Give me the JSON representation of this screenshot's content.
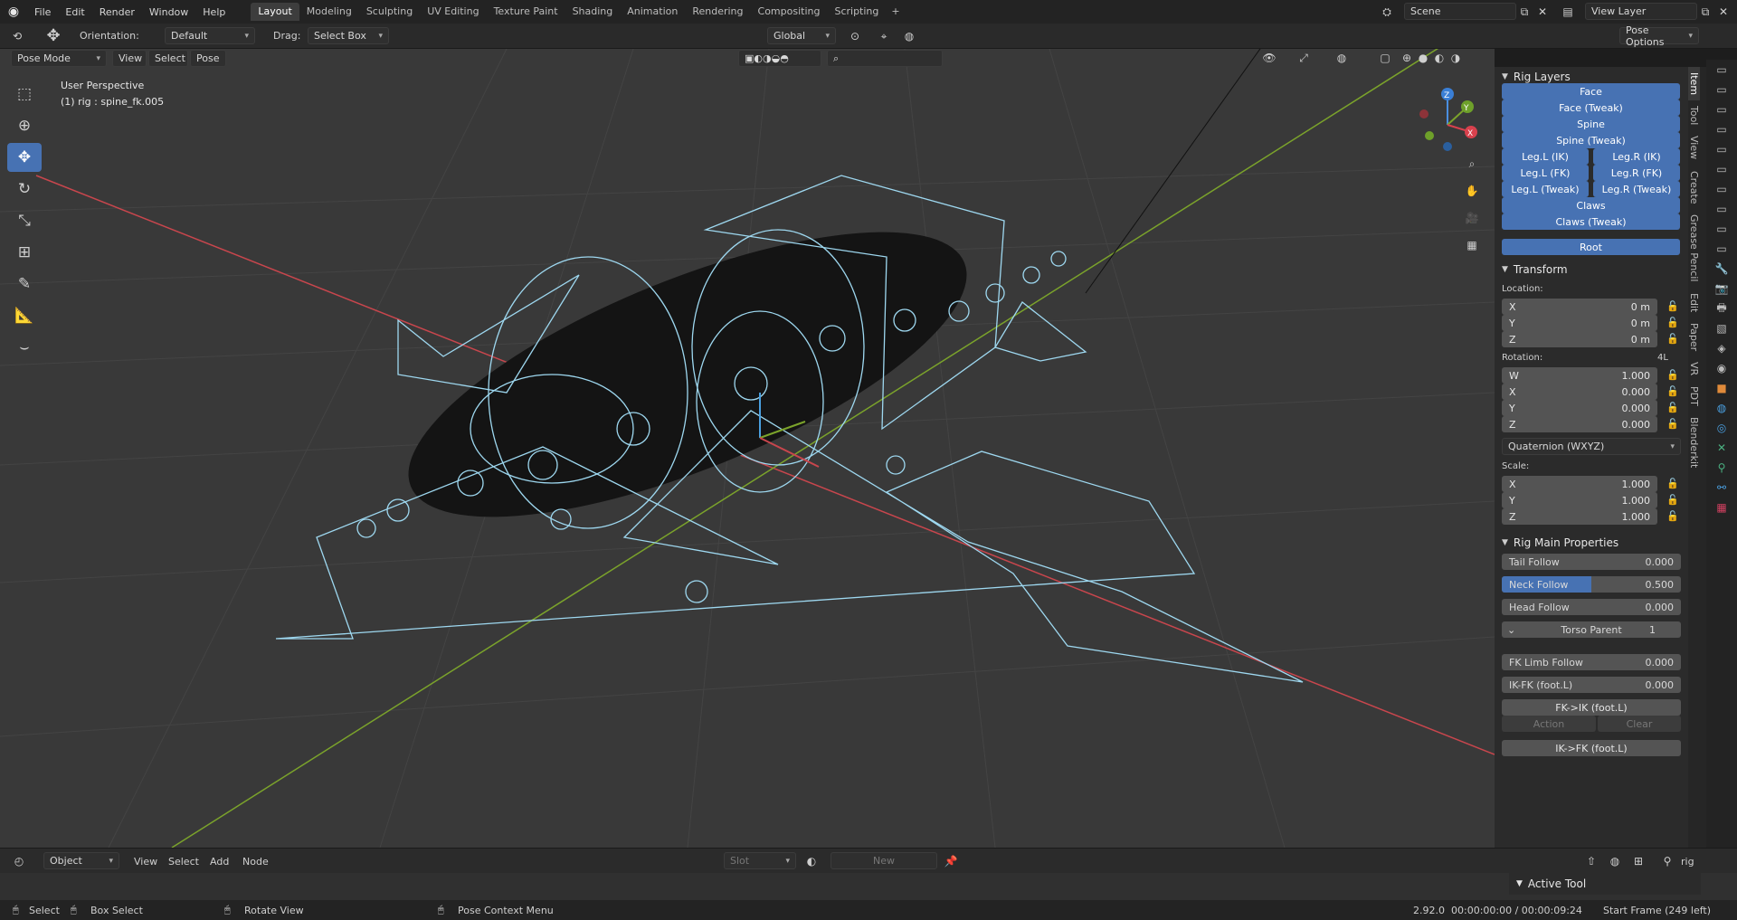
{
  "menu": {
    "items": [
      "File",
      "Edit",
      "Render",
      "Window",
      "Help"
    ]
  },
  "workspaces": {
    "tabs": [
      "Layout",
      "Modeling",
      "Sculpting",
      "UV Editing",
      "Texture Paint",
      "Shading",
      "Animation",
      "Rendering",
      "Compositing",
      "Scripting"
    ],
    "active": "Layout",
    "plus": "+"
  },
  "scene": {
    "label": "Scene",
    "view_layer": "View Layer"
  },
  "header": {
    "orientation_label": "Orientation:",
    "orientation_value": "Default",
    "drag_label": "Drag:",
    "drag_value": "Select Box",
    "transform_orientation": "Global",
    "pose_options": "Pose Options"
  },
  "viewport_header": {
    "mode": "Pose Mode",
    "menus": [
      "View",
      "Select",
      "Pose"
    ]
  },
  "viewport": {
    "perspective": "User Perspective",
    "object_info": "(1) rig : spine_fk.005"
  },
  "axes": {
    "z": "Z",
    "y": "Y",
    "x": "X"
  },
  "npanel": {
    "tabs": [
      "Item",
      "Tool",
      "View",
      "Create",
      "Grease Pencil",
      "Edit",
      "Paper",
      "VR",
      "PDT",
      "Blenderkit"
    ],
    "active_tab": "Item",
    "rig_layers": {
      "title": "Rig Layers",
      "face": "Face",
      "face_tweak": "Face (Tweak)",
      "spine": "Spine",
      "spine_tweak": "Spine (Tweak)",
      "leg_l_ik": "Leg.L (IK)",
      "leg_r_ik": "Leg.R (IK)",
      "leg_l_fk": "Leg.L (FK)",
      "leg_r_fk": "Leg.R (FK)",
      "leg_l_tweak": "Leg.L (Tweak)",
      "leg_r_tweak": "Leg.R (Tweak)",
      "claws": "Claws",
      "claws_tweak": "Claws (Tweak)",
      "root": "Root"
    },
    "transform": {
      "title": "Transform",
      "location_label": "Location:",
      "location": [
        {
          "axis": "X",
          "value": "0 m"
        },
        {
          "axis": "Y",
          "value": "0 m"
        },
        {
          "axis": "Z",
          "value": "0 m"
        }
      ],
      "rotation_label": "Rotation:",
      "rotation_extra": "4L",
      "rotation": [
        {
          "axis": "W",
          "value": "1.000"
        },
        {
          "axis": "X",
          "value": "0.000"
        },
        {
          "axis": "Y",
          "value": "0.000"
        },
        {
          "axis": "Z",
          "value": "0.000"
        }
      ],
      "rotation_mode": "Quaternion (WXYZ)",
      "scale_label": "Scale:",
      "scale": [
        {
          "axis": "X",
          "value": "1.000"
        },
        {
          "axis": "Y",
          "value": "1.000"
        },
        {
          "axis": "Z",
          "value": "1.000"
        }
      ]
    },
    "rig_main": {
      "title": "Rig Main Properties",
      "tail_follow": {
        "label": "Tail Follow",
        "value": "0.000",
        "fraction": 0
      },
      "neck_follow": {
        "label": "Neck Follow",
        "value": "0.500",
        "fraction": 0.5
      },
      "head_follow": {
        "label": "Head Follow",
        "value": "0.000",
        "fraction": 0
      },
      "torso_parent": {
        "label": "Torso Parent",
        "value": "1"
      },
      "fk_limb_follow": {
        "label": "FK Limb Follow",
        "value": "0.000",
        "fraction": 0
      },
      "ik_fk_foot_l": {
        "label": "IK-FK (foot.L)",
        "value": "0.000",
        "fraction": 0
      },
      "fk_ik_btn": "FK->IK (foot.L)",
      "action": "Action",
      "clear": "Clear",
      "ik_fk_btn": "IK->FK (foot.L)"
    }
  },
  "bottom_header": {
    "editor_mode": "Object",
    "menus": [
      "View",
      "Select",
      "Add",
      "Node"
    ],
    "slot": "Slot",
    "new": "New",
    "object_name": "rig"
  },
  "active_tool": {
    "title": "Active Tool"
  },
  "statusbar": {
    "select": "Select",
    "box_select": "Box Select",
    "rotate_view": "Rotate View",
    "pose_context": "Pose Context Menu",
    "version": "2.92.0",
    "time": "00:00:00:00 / 00:00:09:24",
    "start_frame": "Start Frame (249 left)"
  },
  "colors": {
    "accent": "#4772b3",
    "bone_wire": "#9ed8f0",
    "x_axis": "#c8464d",
    "y_axis": "#7ba32b"
  }
}
